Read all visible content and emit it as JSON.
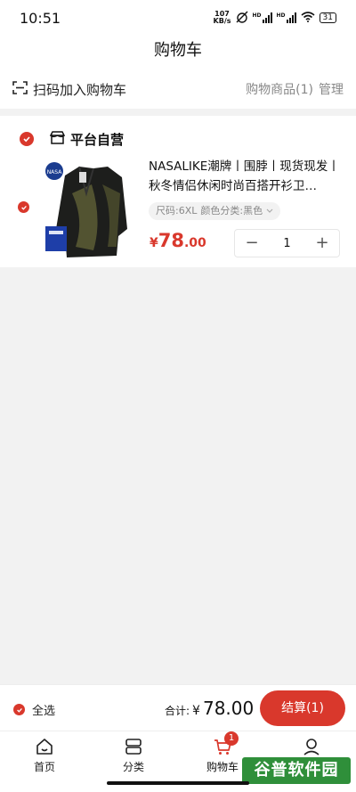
{
  "status_bar": {
    "time": "10:51",
    "net_speed_value": "107",
    "net_speed_unit": "KB/s",
    "signal_1_tag": "HD",
    "signal_2_tag": "HD",
    "battery": "31"
  },
  "header": {
    "title": "购物车"
  },
  "subheader": {
    "scan_label": "扫码加入购物车",
    "items_label": "购物商品(1)",
    "manage_label": "管理"
  },
  "store": {
    "name": "平台自营",
    "product": {
      "image_logo_text": "NASA",
      "title": "NASALIKE潮牌丨围脖丨现货现发丨秋冬情侣休闲时尚百搭开衫卫…",
      "spec_size": "尺码:6XL",
      "spec_color": "颜色分类:黑色",
      "price_symbol": "¥",
      "price_int": "78",
      "price_dec": ".00",
      "quantity": "1",
      "minus": "−",
      "plus": "+"
    }
  },
  "bottom": {
    "select_all_label": "全选",
    "total_label": "合计:",
    "total_symbol": "¥",
    "total_amount": "78.00",
    "checkout_label": "结算(1)"
  },
  "tabs": [
    {
      "label": "首页",
      "icon": "home-icon"
    },
    {
      "label": "分类",
      "icon": "category-icon"
    },
    {
      "label": "购物车",
      "icon": "cart-icon",
      "badge": "1"
    },
    {
      "label": "我的",
      "icon": "profile-icon"
    }
  ],
  "watermark": {
    "text": "谷普软件园"
  },
  "colors": {
    "accent": "#d9382c",
    "background": "#f2f2f2"
  }
}
